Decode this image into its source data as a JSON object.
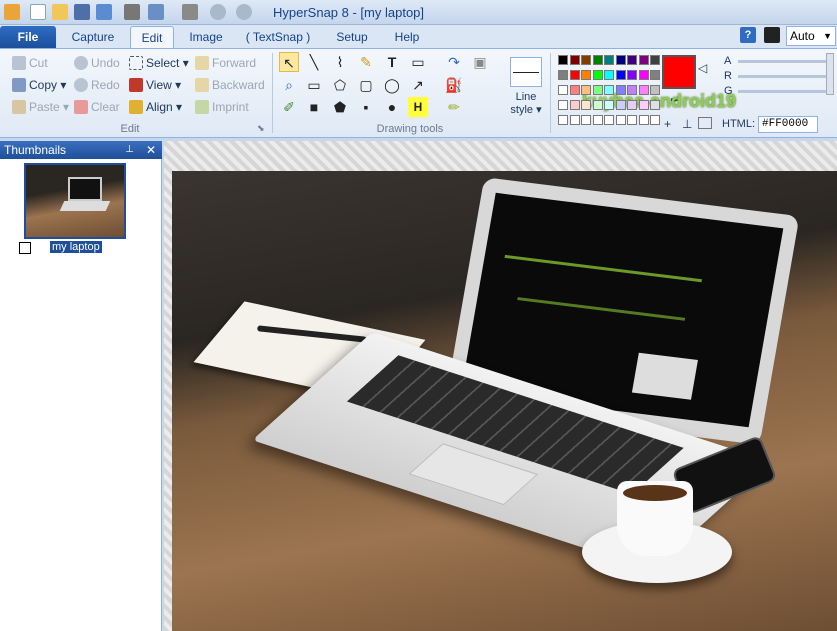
{
  "window": {
    "title": "HyperSnap 8 - [my laptop]"
  },
  "tabs": [
    {
      "label": "File"
    },
    {
      "label": "Capture"
    },
    {
      "label": "Edit"
    },
    {
      "label": "Image"
    },
    {
      "label": "( TextSnap )"
    },
    {
      "label": "Setup"
    },
    {
      "label": "Help"
    }
  ],
  "zoom": {
    "value": "Auto"
  },
  "edit_group": {
    "label": "Edit",
    "cut": "Cut",
    "copy": "Copy",
    "paste": "Paste",
    "undo": "Undo",
    "redo": "Redo",
    "clear": "Clear",
    "select": "Select",
    "view": "View",
    "align": "Align",
    "forward": "Forward",
    "backward": "Backward",
    "imprint": "Imprint"
  },
  "drawing_group": {
    "label": "Drawing tools",
    "line_style": "Line style"
  },
  "color": {
    "hex": "#FF0000",
    "html_label": "HTML:",
    "a": "A",
    "r": "R",
    "g": "G"
  },
  "thumbnails": {
    "title": "Thumbnails",
    "items": [
      {
        "caption": "my laptop"
      }
    ]
  },
  "watermark": "kuyhaa-android19"
}
